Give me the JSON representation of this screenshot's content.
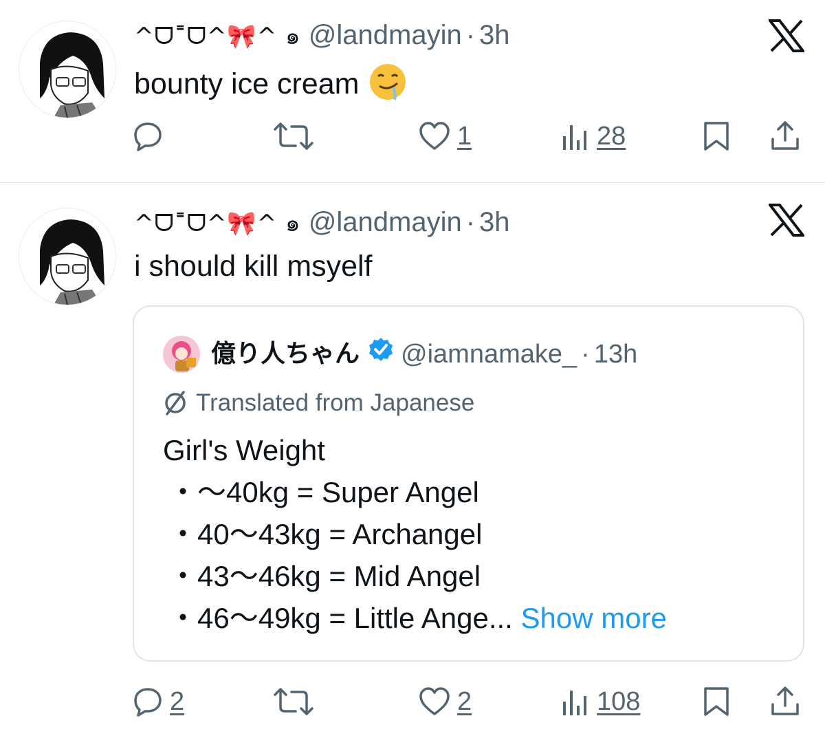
{
  "tweets": [
    {
      "display_name": "^ᗜ˭ᗜ^🎀^ ๑",
      "handle": "@landmayin",
      "separator": "·",
      "time": "3h",
      "text": "bounty ice cream",
      "emoji": "drooling-face",
      "counts": {
        "reply": "",
        "retweet": "",
        "like": "1",
        "views": "28"
      }
    },
    {
      "display_name": "^ᗜ˭ᗜ^🎀^ ๑",
      "handle": "@landmayin",
      "separator": "·",
      "time": "3h",
      "text": "i should kill msyelf",
      "counts": {
        "reply": "2",
        "retweet": "",
        "like": "2",
        "views": "108"
      },
      "quote": {
        "display_name": "億り人ちゃん",
        "handle": "@iamnamake_",
        "separator": "·",
        "time": "13h",
        "translated_label": "Translated from Japanese",
        "title": "Girl's Weight",
        "lines": [
          "・～40kg = Super Angel",
          "・40～43kg = Archangel",
          "・43～46kg = Mid Angel",
          "・46～49kg = Little Ange..."
        ],
        "show_more": "Show more"
      }
    }
  ],
  "colors": {
    "text": "#0f1419",
    "secondary": "#536471",
    "link": "#1d9bf0",
    "verified": "#1d9bf0",
    "divider": "#e1e6ea"
  }
}
